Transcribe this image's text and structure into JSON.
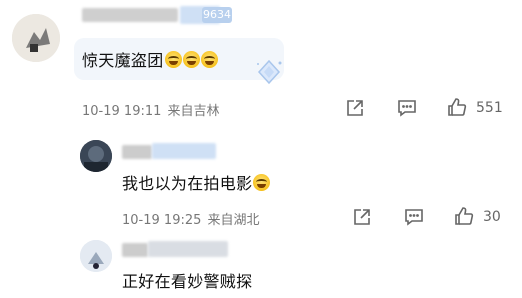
{
  "comments": [
    {
      "content": "惊天魔盗团",
      "date": "10-19",
      "time": "19:11",
      "location": "来自吉林",
      "likes": "551",
      "badge_text": "9634"
    },
    {
      "content": "我也以为在拍电影",
      "date": "10-19",
      "time": "19:25",
      "location": "来自湖北",
      "likes": "30"
    },
    {
      "content": "正好在看妙警贼探"
    }
  ],
  "icons": [
    "share-icon",
    "comment-icon",
    "like-icon",
    "laugh-emoji",
    "diamond-badge-icon"
  ],
  "colors": {
    "meta_text": "#777777",
    "bubble_bg": "#f2f6fb",
    "badge_blue": "#a9c6ec"
  }
}
